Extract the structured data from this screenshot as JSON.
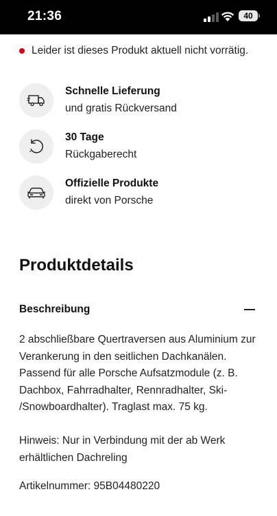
{
  "status_bar": {
    "time": "21:36",
    "battery": "40"
  },
  "availability": {
    "text": "Leider ist dieses Produkt aktuell nicht vorrätig.",
    "indicator_color": "#d5001c"
  },
  "features": [
    {
      "icon": "delivery-truck-icon",
      "title": "Schnelle Lieferung",
      "subtitle": "und gratis Rückversand"
    },
    {
      "icon": "return-cycle-icon",
      "title": "30 Tage",
      "subtitle": "Rückgaberecht"
    },
    {
      "icon": "car-icon",
      "title": "Offizielle Produkte",
      "subtitle": "direkt von Porsche"
    }
  ],
  "product_details": {
    "heading": "Produktdetails",
    "accordion": {
      "label": "Beschreibung",
      "lines": [
        "2 abschließbare Quertraversen aus Aluminium zur",
        "Verankerung in den seitlichen Dachkanälen.",
        "Passend für alle Porsche Aufsatzmodule (z. B.",
        "Dachbox, Fahrradhalter, Rennradhalter, Ski-",
        "/Snowboardhalter). Traglast max. 75 kg."
      ],
      "hint_lines": [
        "Hinweis: Nur in Verbindung mit der ab Werk",
        "erhältlichen Dachreling"
      ],
      "article_number": "Artikelnummer: 95B04480220"
    }
  }
}
